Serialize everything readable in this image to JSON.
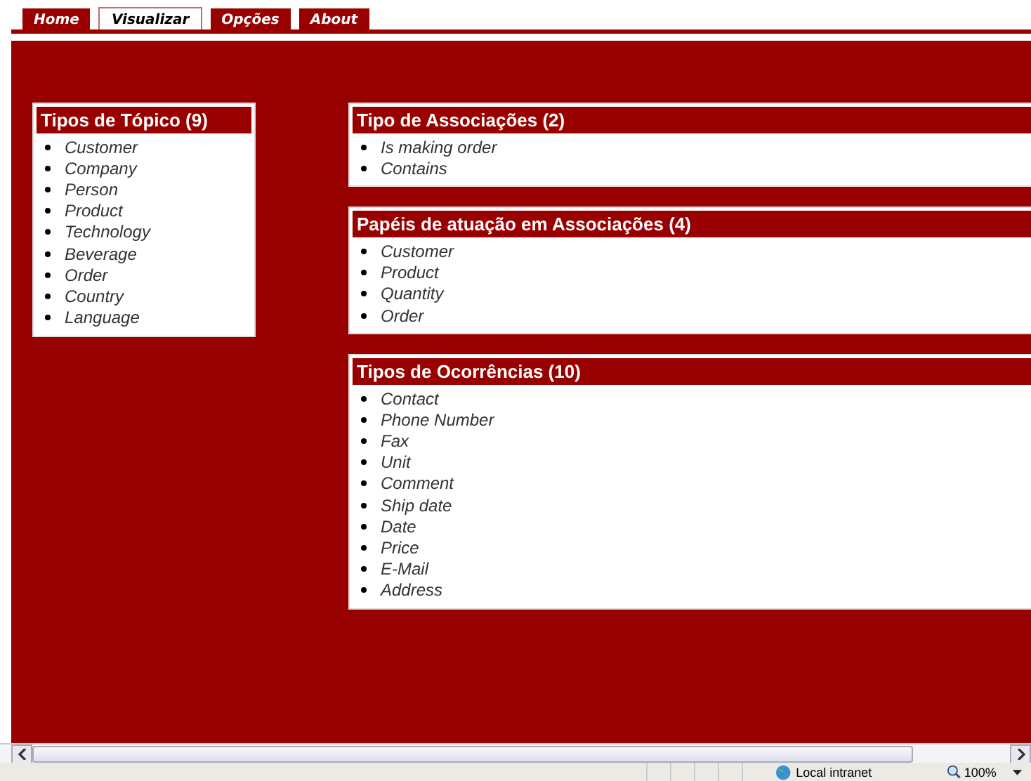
{
  "tabs": [
    {
      "label": "Home",
      "selected": false
    },
    {
      "label": "Visualizar",
      "selected": true
    },
    {
      "label": "Opções",
      "selected": false
    },
    {
      "label": "About",
      "selected": false
    }
  ],
  "left_panels": [
    {
      "title": "Tipos de Tópico (9)",
      "items": [
        "Customer",
        "Company",
        "Person",
        "Product",
        "Technology",
        "Beverage",
        "Order",
        "Country",
        "Language"
      ]
    }
  ],
  "right_panels": [
    {
      "title": "Tipo de Associações (2)",
      "items": [
        "Is making order",
        "Contains"
      ]
    },
    {
      "title": "Papéis de atuação em Associações (4)",
      "items": [
        "Customer",
        "Product",
        "Quantity",
        "Order"
      ]
    },
    {
      "title": "Tipos de Ocorrências (10)",
      "items": [
        "Contact",
        "Phone Number",
        "Fax",
        "Unit",
        "Comment",
        "Ship date",
        "Date",
        "Price",
        "E-Mail",
        "Address"
      ]
    }
  ],
  "status_bar": {
    "zone": "Local intranet",
    "zoom": "100%"
  }
}
